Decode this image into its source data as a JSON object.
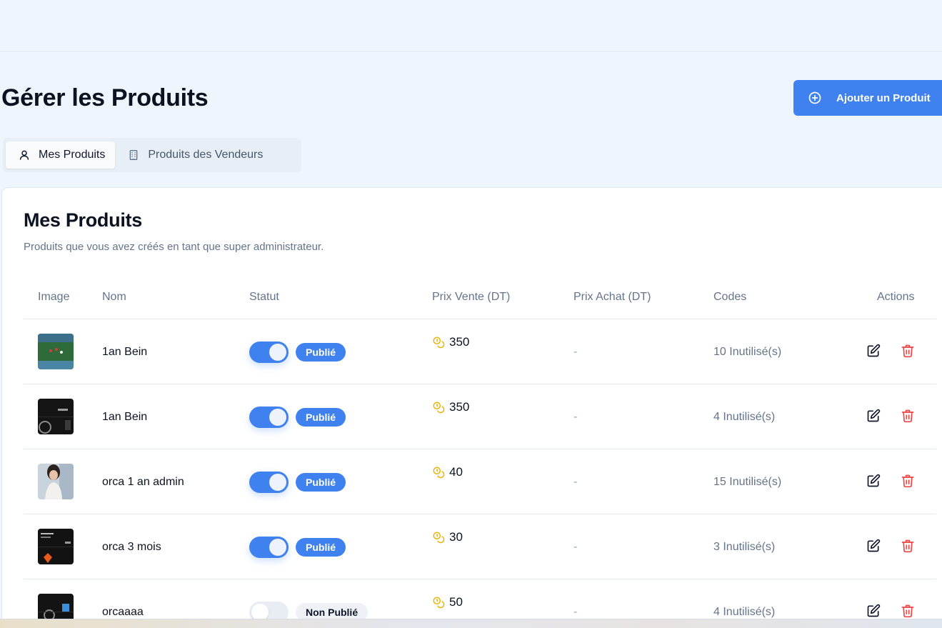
{
  "header": {
    "page_title": "Gérer les Produits",
    "add_button_label": "Ajouter un Produit",
    "add_icon": "plus-circle-icon"
  },
  "tabs": [
    {
      "label": "Mes Produits",
      "icon": "user-icon",
      "active": true
    },
    {
      "label": "Produits des Vendeurs",
      "icon": "building-icon",
      "active": false
    }
  ],
  "card": {
    "title": "Mes Produits",
    "subtitle": "Produits que vous avez créés en tant que super administrateur."
  },
  "table": {
    "columns": [
      "Image",
      "Nom",
      "Statut",
      "Prix Vente (DT)",
      "Prix Achat (DT)",
      "Codes",
      "Actions"
    ],
    "rows": [
      {
        "name": "1an Bein",
        "published": true,
        "status": "Publié",
        "price": "350",
        "purchase": "-",
        "codes": "10 Inutilisé(s)"
      },
      {
        "name": "1an Bein",
        "published": true,
        "status": "Publié",
        "price": "350",
        "purchase": "-",
        "codes": "4 Inutilisé(s)"
      },
      {
        "name": "orca 1 an admin",
        "published": true,
        "status": "Publié",
        "price": "40",
        "purchase": "-",
        "codes": "15 Inutilisé(s)"
      },
      {
        "name": "orca 3 mois",
        "published": true,
        "status": "Publié",
        "price": "30",
        "purchase": "-",
        "codes": "3 Inutilisé(s)"
      },
      {
        "name": "orcaaaa",
        "published": false,
        "status": "Non Publié",
        "price": "50",
        "purchase": "-",
        "codes": "4 Inutilisé(s)"
      }
    ]
  },
  "colors": {
    "primary": "#3f82ef",
    "background": "#eff5fc",
    "danger": "#ef4444",
    "coin": "#eab308"
  },
  "icons": {
    "price": "coins-icon",
    "edit": "edit-icon",
    "delete": "trash-icon"
  }
}
